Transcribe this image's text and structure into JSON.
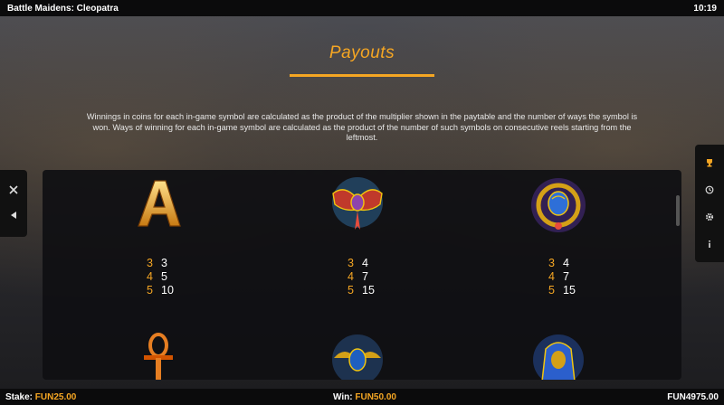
{
  "header": {
    "game_title": "Battle Maidens: Cleopatra",
    "clock": "10:19"
  },
  "page": {
    "title": "Payouts",
    "description": "Winnings in coins for each in-game symbol are calculated as the product of the multiplier shown in the paytable and the number of ways the symbol is won. Ways of winning for each in-game symbol are calculated as the product of the number of such symbols on consecutive reels starting from the leftmost."
  },
  "symbols": [
    {
      "icon": "letter-a-icon",
      "pays": [
        {
          "count": "3",
          "value": "3"
        },
        {
          "count": "4",
          "value": "5"
        },
        {
          "count": "5",
          "value": "10"
        }
      ]
    },
    {
      "icon": "winged-scarab-pendant-icon",
      "pays": [
        {
          "count": "3",
          "value": "4"
        },
        {
          "count": "4",
          "value": "7"
        },
        {
          "count": "5",
          "value": "15"
        }
      ]
    },
    {
      "icon": "scarab-ring-icon",
      "pays": [
        {
          "count": "3",
          "value": "4"
        },
        {
          "count": "4",
          "value": "7"
        },
        {
          "count": "5",
          "value": "15"
        }
      ]
    }
  ],
  "next_row_icons": [
    "ankh-icon",
    "winged-scarab-helmet-icon",
    "pharaoh-mask-icon"
  ],
  "sidebar_left": {
    "icons": [
      "close-icon",
      "back-arrow-icon"
    ]
  },
  "sidebar_right": {
    "icons": [
      "trophy-icon",
      "history-icon",
      "settings-icon",
      "info-icon"
    ]
  },
  "footer": {
    "stake_label": "Stake:",
    "stake_value": "FUN25.00",
    "win_label": "Win:",
    "win_value": "FUN50.00",
    "balance_value": "FUN4975.00"
  },
  "colors": {
    "accent": "#f5a623",
    "panel": "#0f0f12",
    "bar": "#0b0b0c"
  }
}
